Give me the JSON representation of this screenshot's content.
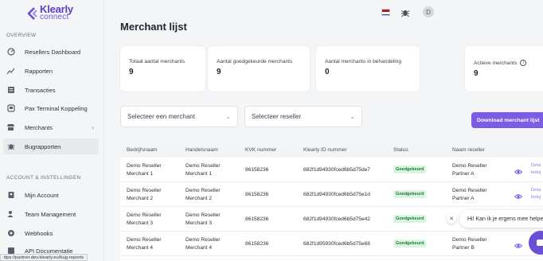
{
  "brand": {
    "line1": "Klearly",
    "line2": "connect"
  },
  "sidebar": {
    "overview_label": "OVERVIEW",
    "items": [
      {
        "label": "Resellers Dashboard",
        "icon": "dashboard-icon"
      },
      {
        "label": "Rapporten",
        "icon": "chart-icon"
      },
      {
        "label": "Transacties",
        "icon": "transactions-icon"
      },
      {
        "label": "Pax Terminal Koppeling",
        "icon": "terminal-icon"
      },
      {
        "label": "Merchants",
        "icon": "merchants-icon"
      },
      {
        "label": "Bugrapporten",
        "icon": "bug-icon"
      }
    ],
    "account_label": "ACCOUNT & INSTELLINGEN",
    "account_items": [
      {
        "label": "Mijn Account",
        "icon": "account-icon"
      },
      {
        "label": "Team Management",
        "icon": "team-icon"
      },
      {
        "label": "Webhooks",
        "icon": "webhook-icon"
      },
      {
        "label": "API Documentatie",
        "icon": "api-icon"
      }
    ]
  },
  "status_url": "ttps://partner.dev.klearly.eu/bug-reports",
  "header": {
    "avatar_initial": "D"
  },
  "page": {
    "title": "Merchant lijst"
  },
  "stats": [
    {
      "label": "Totaal aantal merchants",
      "value": "9"
    },
    {
      "label": "Aantal goedgekeurde merchants",
      "value": "9"
    },
    {
      "label": "Aantal merchants in behandeling",
      "value": "0"
    },
    {
      "label": "Actieve merchants",
      "value": "9"
    }
  ],
  "filters": {
    "merchant_placeholder": "Selecteer een merchant",
    "reseller_placeholder": "Selecteer reseller",
    "download_label": "Download merchant lijst"
  },
  "table": {
    "columns": [
      "Bedrijfsnaam",
      "Handelsnaam",
      "KVK nummer",
      "Klearly ID nummer",
      "Status",
      "Naam reseller"
    ],
    "rows": [
      {
        "bedrijf1": "Demo Reseller",
        "bedrijf2": "Merchant 1",
        "handel1": "Demo Reseller",
        "handel2": "Merchant 1",
        "kvk": "86158236",
        "kid": "682f1d94930fced6b5d75de7",
        "status": "Goedgekeurd",
        "res1": "Demo Reseller",
        "res2": "Partner A",
        "det1": "Deta",
        "det2": "bekij"
      },
      {
        "bedrijf1": "Demo Reseller",
        "bedrijf2": "Merchant 2",
        "handel1": "Demo Reseller",
        "handel2": "Merchant 2",
        "kvk": "86158236",
        "kid": "682f1d94930fced6b5d75e1d",
        "status": "Goedgekeurd",
        "res1": "Demo Reseller",
        "res2": "Partner A",
        "det1": "Deta",
        "det2": "bekij"
      },
      {
        "bedrijf1": "Demo Reseller",
        "bedrijf2": "Merchant 3",
        "handel1": "Demo Reseller",
        "handel2": "Merchant 3",
        "kvk": "86158236",
        "kid": "682f1d94930fced6b5d75e42",
        "status": "Goedgekeurd",
        "res1": "",
        "res2": "",
        "det1": "",
        "det2": ""
      },
      {
        "bedrijf1": "Demo Reseller",
        "bedrijf2": "Merchant 4",
        "handel1": "Demo Reseller",
        "handel2": "Merchant 4",
        "kvk": "86158236",
        "kid": "682f1d95930fced6b5d75e68",
        "status": "Goedgekeurd",
        "res1": "Demo Reseller",
        "res2": "Partner B",
        "det1": "",
        "det2": ""
      }
    ]
  },
  "chat": {
    "message": "Hi! Kan ik je ergens mee helpe"
  },
  "colors": {
    "accent": "#7b5ce6",
    "badge_bg": "#d9f5df",
    "badge_text": "#1e7a3a"
  }
}
